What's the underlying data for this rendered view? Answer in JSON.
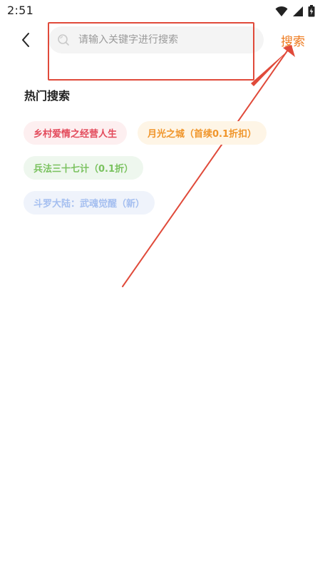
{
  "status_bar": {
    "time": "2:51",
    "icons": [
      "wifi-icon",
      "signal-icon",
      "battery-icon"
    ]
  },
  "header": {
    "search_placeholder": "请输入关键字进行搜索",
    "search_button_label": "搜索"
  },
  "hot_search": {
    "title": "热门搜索",
    "tags": [
      {
        "label": "乡村爱情之经营人生",
        "color": "#e34a5b"
      },
      {
        "label": "月光之城（首续0.1折扣）",
        "color": "#f0952a"
      },
      {
        "label": "兵法三十七计（0.1折）",
        "color": "#7ac25f"
      },
      {
        "label": "斗罗大陆：武魂觉醒（新）",
        "color": "#a5bff0"
      }
    ]
  },
  "colors": {
    "accent": "#ee7a1e",
    "annotation": "#e04a3a"
  }
}
